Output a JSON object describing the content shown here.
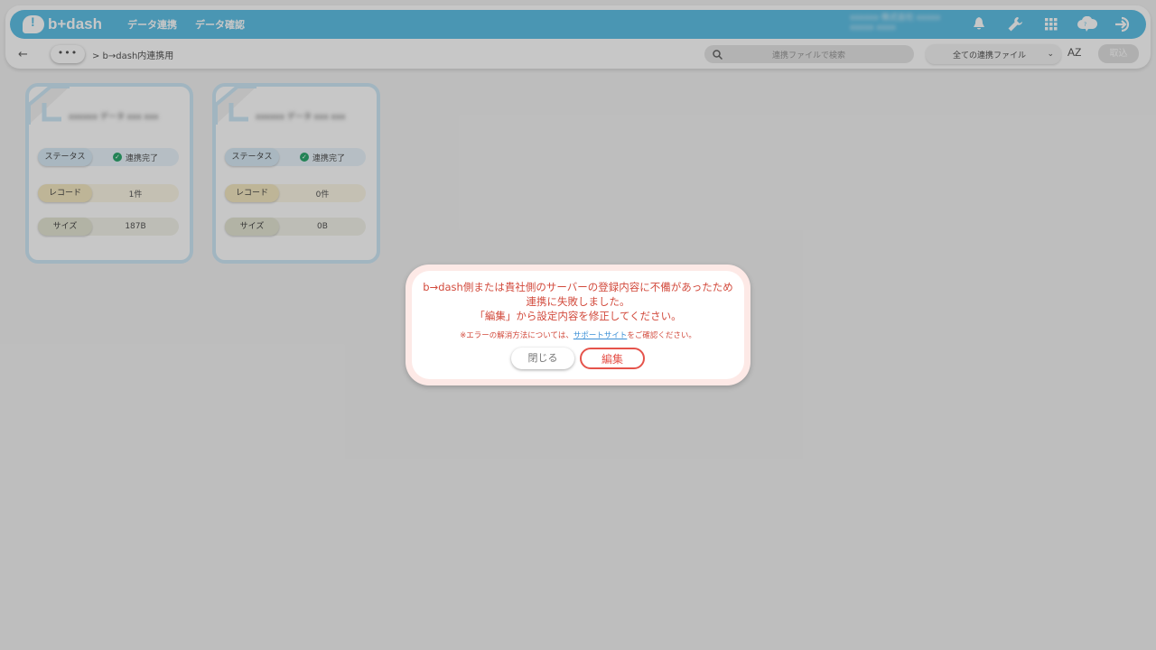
{
  "header": {
    "logo_text": "b+dash",
    "nav": [
      "データ連携",
      "データ確認"
    ],
    "tenant_line1": "xxxxxx 株式会社 xxxxx",
    "tenant_line2": "xxxxx xxxx"
  },
  "subbar": {
    "dots": "•••",
    "breadcrumb": "> b→dash内連携用",
    "search_placeholder": "連携ファイルで検索",
    "filter_value": "全ての連携ファイル",
    "sort_icon": "AZ",
    "import_label": "取込"
  },
  "cards": [
    {
      "name": "xxxxxx データ xxx xxx",
      "status_label": "ステータス",
      "status_value": "連携完了",
      "record_label": "レコード",
      "record_value": "1件",
      "size_label": "サイズ",
      "size_value": "187B"
    },
    {
      "name": "xxxxxx データ xxx xxx",
      "status_label": "ステータス",
      "status_value": "連携完了",
      "record_label": "レコード",
      "record_value": "0件",
      "size_label": "サイズ",
      "size_value": "0B"
    }
  ],
  "modal": {
    "line1": "b→dash側または貴社側のサーバーの登録内容に不備があったため",
    "line2": "連携に失敗しました。",
    "line3": "「編集」から設定内容を修正してください。",
    "note_before": "※エラーの解消方法については、",
    "note_link": "サポートサイト",
    "note_after": "をご確認ください。",
    "close_label": "閉じる",
    "edit_label": "編集"
  }
}
